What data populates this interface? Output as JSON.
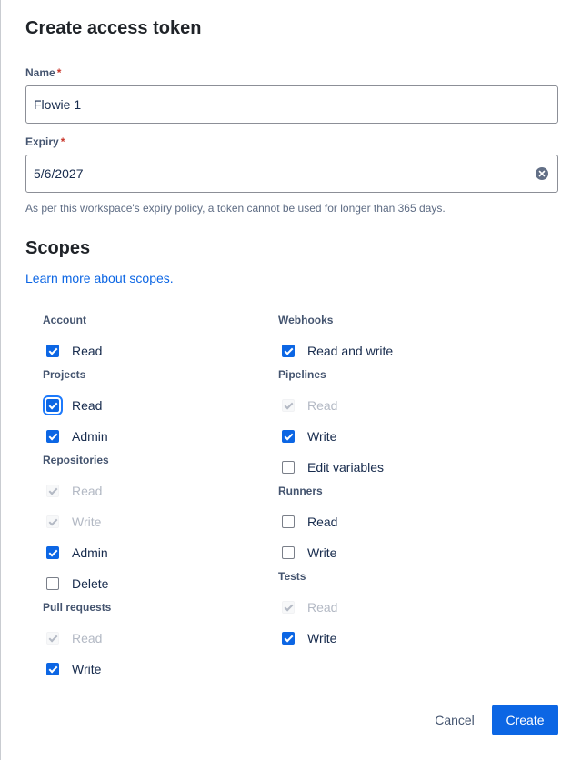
{
  "dialog": {
    "title": "Create access token",
    "name_label": "Name",
    "name_value": "Flowie 1",
    "expiry_label": "Expiry",
    "expiry_value": "5/6/2027",
    "required_mark": "*",
    "expiry_helper": "As per this workspace's expiry policy, a token cannot be used for longer than 365 days.",
    "scopes_title": "Scopes",
    "learn_more": "Learn more about scopes.",
    "cancel_label": "Cancel",
    "create_label": "Create",
    "accent_color": "#0c66e4",
    "required_color": "#c9372c"
  },
  "scopes": {
    "left": [
      {
        "heading": "Account",
        "items": [
          {
            "label": "Read",
            "state": "checked"
          }
        ]
      },
      {
        "heading": "Projects",
        "items": [
          {
            "label": "Read",
            "state": "checked-focused"
          },
          {
            "label": "Admin",
            "state": "checked"
          }
        ]
      },
      {
        "heading": "Repositories",
        "items": [
          {
            "label": "Read",
            "state": "disabled"
          },
          {
            "label": "Write",
            "state": "disabled"
          },
          {
            "label": "Admin",
            "state": "checked"
          },
          {
            "label": "Delete",
            "state": "unchecked"
          }
        ]
      },
      {
        "heading": "Pull requests",
        "items": [
          {
            "label": "Read",
            "state": "disabled"
          },
          {
            "label": "Write",
            "state": "checked"
          }
        ]
      }
    ],
    "right": [
      {
        "heading": "Webhooks",
        "items": [
          {
            "label": "Read and write",
            "state": "checked"
          }
        ]
      },
      {
        "heading": "Pipelines",
        "items": [
          {
            "label": "Read",
            "state": "disabled"
          },
          {
            "label": "Write",
            "state": "checked"
          },
          {
            "label": "Edit variables",
            "state": "unchecked"
          }
        ]
      },
      {
        "heading": "Runners",
        "items": [
          {
            "label": "Read",
            "state": "unchecked"
          },
          {
            "label": "Write",
            "state": "unchecked"
          }
        ]
      },
      {
        "heading": "Tests",
        "items": [
          {
            "label": "Read",
            "state": "disabled"
          },
          {
            "label": "Write",
            "state": "checked"
          }
        ]
      }
    ]
  },
  "icons": {
    "clear": "clear-circle-icon",
    "check": "checkmark-icon"
  }
}
